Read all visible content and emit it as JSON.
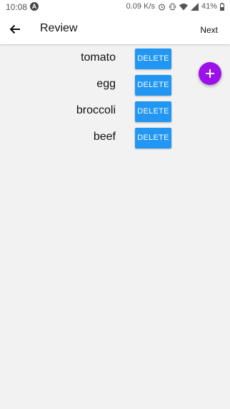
{
  "status_bar": {
    "time": "10:08",
    "notification_icon": "a-icon",
    "speed": "0.09 K/s",
    "battery": "41%"
  },
  "app_bar": {
    "back_icon": "arrow-left-icon",
    "title": "Review",
    "next_label": "Next"
  },
  "items": [
    {
      "name": "tomato",
      "delete_label": "DELETE"
    },
    {
      "name": "egg",
      "delete_label": "DELETE"
    },
    {
      "name": "broccoli",
      "delete_label": "DELETE"
    },
    {
      "name": "beef",
      "delete_label": "DELETE"
    }
  ],
  "fab": {
    "icon": "plus-icon",
    "color": "#9c10ea"
  },
  "colors": {
    "delete_button": "#2196f3",
    "background": "#f2f2f2"
  }
}
